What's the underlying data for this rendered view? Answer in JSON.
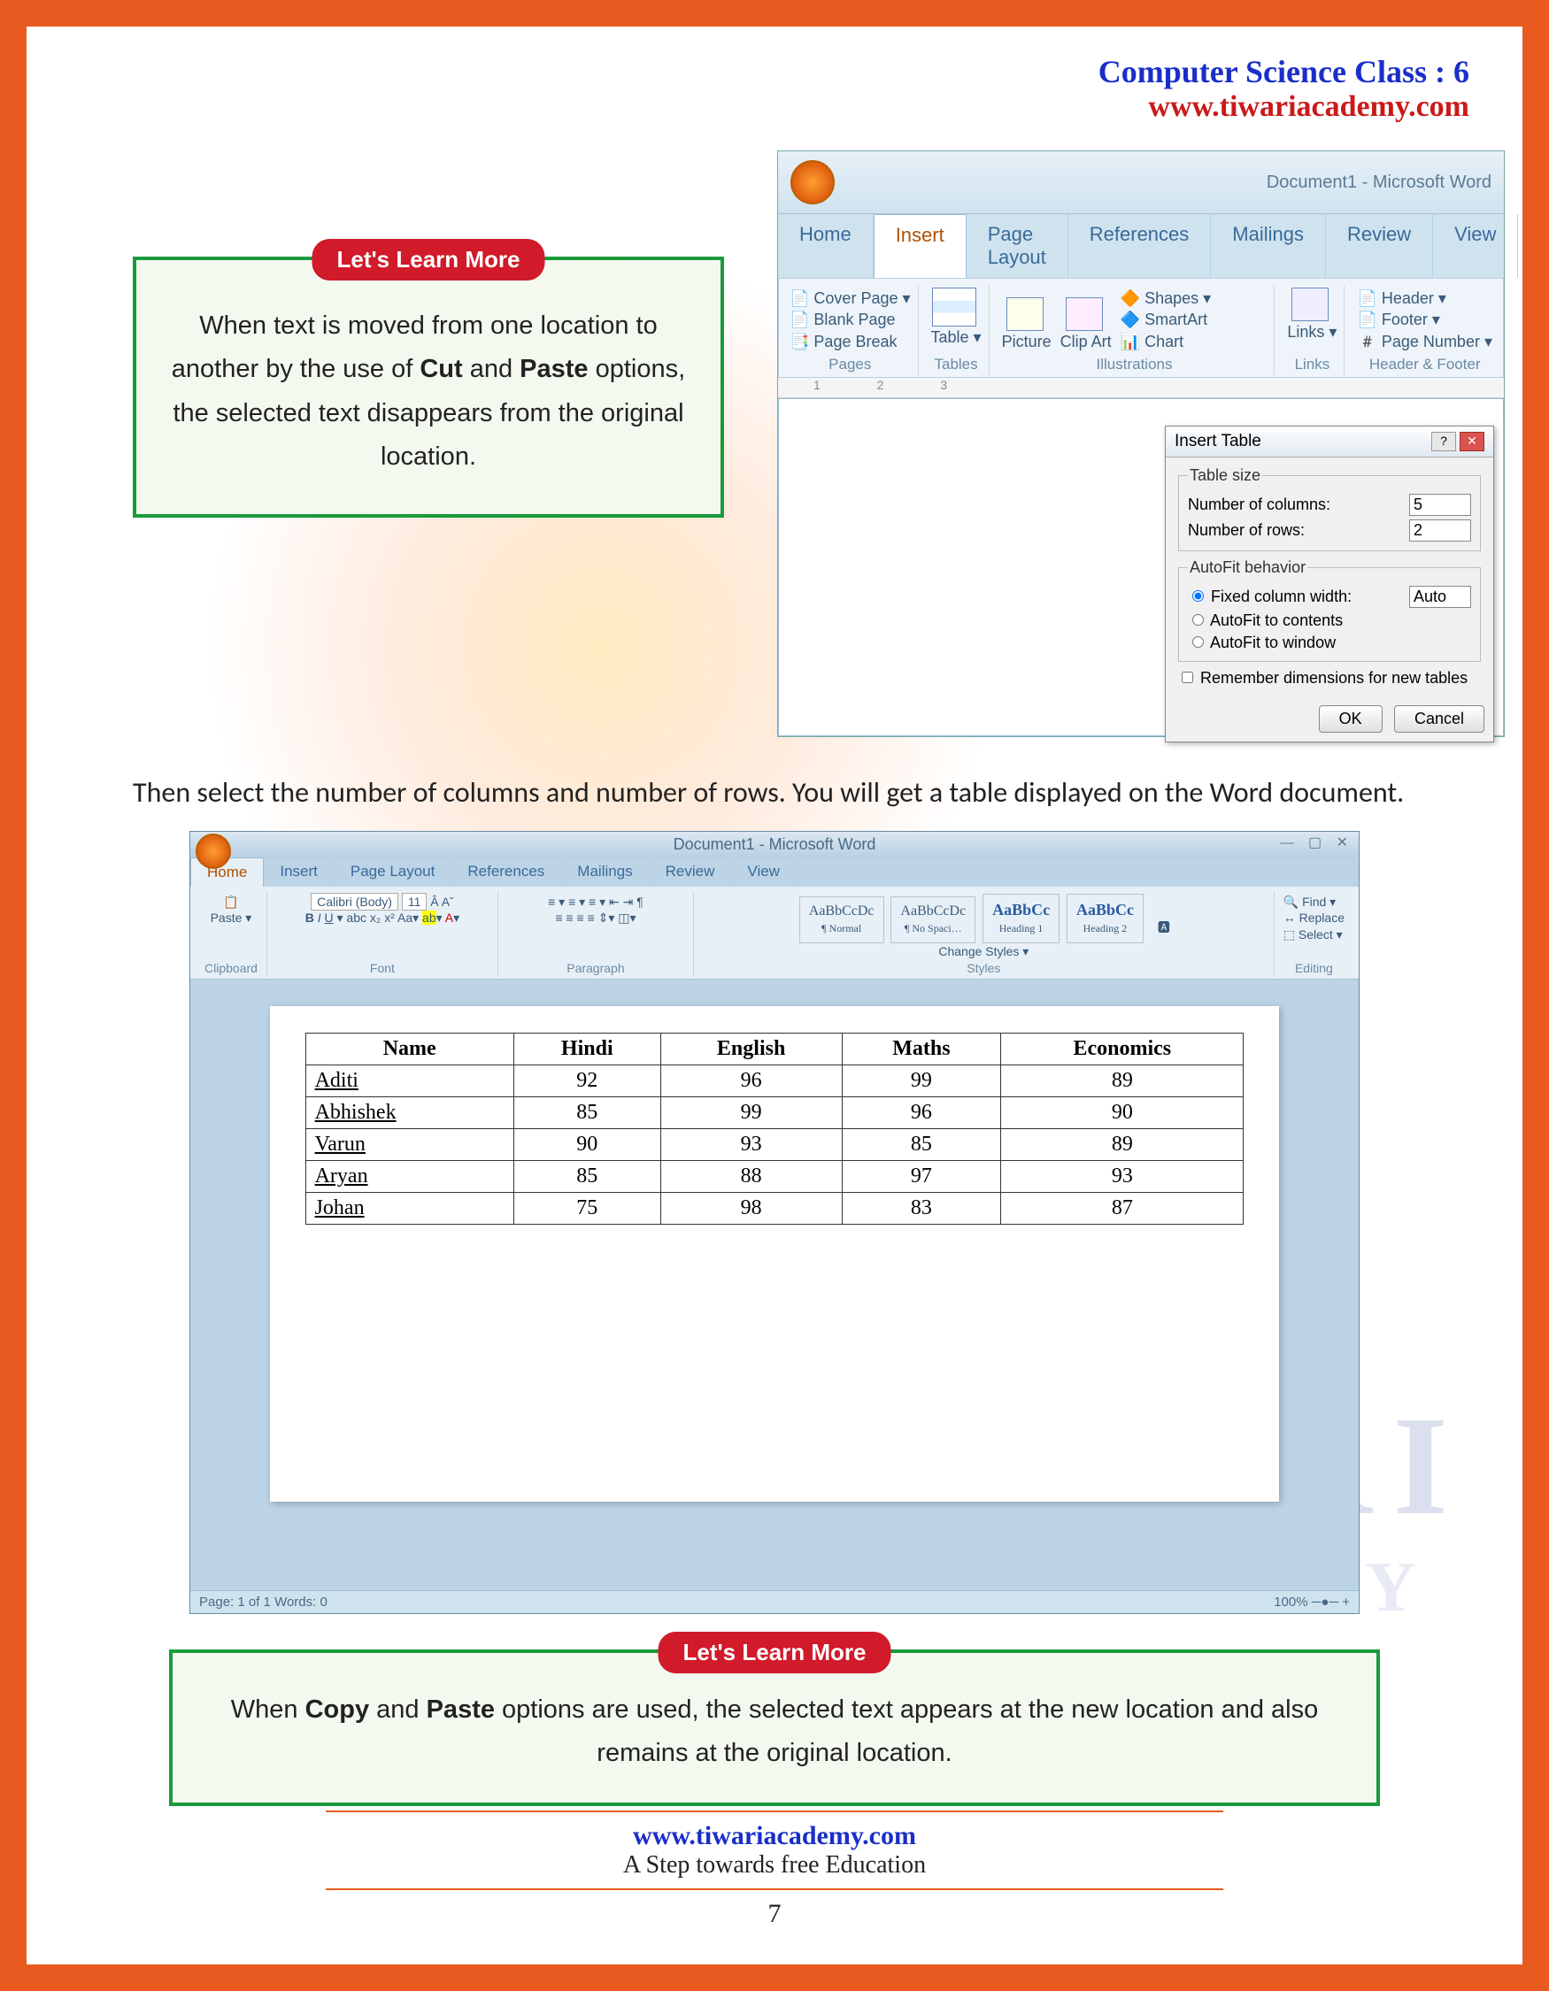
{
  "header": {
    "title": "Computer Science Class : 6",
    "site": "www.tiwariacademy.com"
  },
  "watermark": {
    "line1": "TIWARI",
    "line2": "A C A D E M Y"
  },
  "learn_more_badge": "Let's Learn More",
  "box1": {
    "pre": "When text is moved from one location to another by the use of ",
    "b1": "Cut",
    "mid": " and ",
    "b2": "Paste",
    "post": " options, the selected text disappears from the original location."
  },
  "word1": {
    "title": "Document1 - Microsoft Word",
    "tabs": [
      "Home",
      "Insert",
      "Page Layout",
      "References",
      "Mailings",
      "Review",
      "View"
    ],
    "active_tab": "Insert",
    "groups": {
      "pages": {
        "name": "Pages",
        "items": [
          "Cover Page ▾",
          "Blank Page",
          "Page Break"
        ]
      },
      "tables": {
        "name": "Tables",
        "label": "Table"
      },
      "illus": {
        "name": "Illustrations",
        "items": [
          "Picture",
          "Clip Art",
          "Shapes ▾",
          "SmartArt",
          "Chart"
        ]
      },
      "links": {
        "name": "Links",
        "label": "Links"
      },
      "hf": {
        "name": "Header & Footer",
        "items": [
          "Header ▾",
          "Footer ▾",
          "Page Number ▾"
        ]
      }
    },
    "dialog": {
      "title": "Insert Table",
      "size_legend": "Table size",
      "cols_label": "Number of columns:",
      "cols": "5",
      "rows_label": "Number of rows:",
      "rows": "2",
      "autofit_legend": "AutoFit behavior",
      "opt1": "Fixed column width:",
      "opt1_val": "Auto",
      "opt2": "AutoFit to contents",
      "opt3": "AutoFit to window",
      "remember": "Remember dimensions for new tables",
      "ok": "OK",
      "cancel": "Cancel"
    },
    "ruler": "1   2   3"
  },
  "paragraph": "Then select the number of columns and number of rows. You will get a table displayed on the Word document.",
  "word2": {
    "title": "Document1 - Microsoft Word",
    "tabs": [
      "Home",
      "Insert",
      "Page Layout",
      "References",
      "Mailings",
      "Review",
      "View"
    ],
    "active_tab": "Home",
    "clipboard": {
      "name": "Clipboard",
      "paste": "Paste"
    },
    "font": {
      "name": "Font",
      "family": "Calibri (Body)",
      "size": "11"
    },
    "paragraph_group": "Paragraph",
    "styles": {
      "name": "Styles",
      "items": [
        "AaBbCcDc",
        "AaBbCcDc",
        "AaBbCc",
        "AaBbCc"
      ],
      "labels": [
        "¶ Normal",
        "¶ No Spaci…",
        "Heading 1",
        "Heading 2"
      ],
      "change": "Change Styles ▾"
    },
    "editing": {
      "name": "Editing",
      "items": [
        "Find ▾",
        "Replace",
        "Select ▾"
      ]
    },
    "status": {
      "left": "Page: 1 of 1    Words: 0",
      "right": "100%  ─●─  +"
    }
  },
  "chart_data": {
    "type": "table",
    "headers": [
      "Name",
      "Hindi",
      "English",
      "Maths",
      "Economics"
    ],
    "rows": [
      [
        "Aditi",
        "92",
        "96",
        "99",
        "89"
      ],
      [
        "Abhishek",
        "85",
        "99",
        "96",
        "90"
      ],
      [
        "Varun",
        "90",
        "93",
        "85",
        "89"
      ],
      [
        "Aryan",
        "85",
        "88",
        "97",
        "93"
      ],
      [
        "Johan",
        "75",
        "98",
        "83",
        "87"
      ]
    ]
  },
  "box2": {
    "pre": "When ",
    "b1": "Copy",
    "mid": " and ",
    "b2": "Paste",
    "post": " options are used, the selected text appears at the new location and also remains at the original location."
  },
  "footer": {
    "site": "www.tiwariacademy.com",
    "tag": "A Step towards free Education",
    "page": "7"
  }
}
